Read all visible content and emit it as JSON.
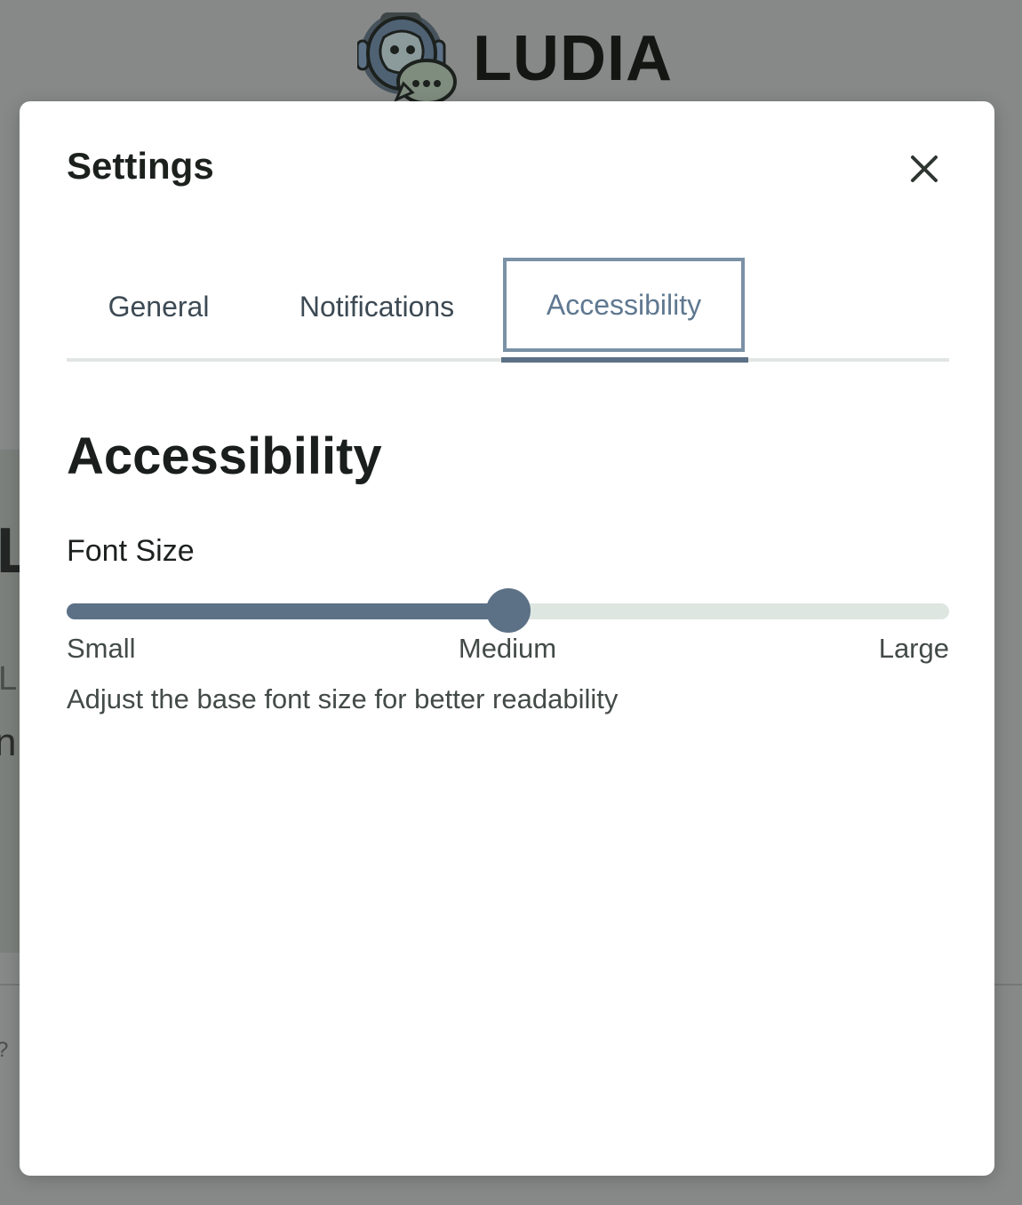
{
  "app": {
    "logo_text": "LUDIA",
    "logo_icon": "chat-robot-icon"
  },
  "background": {
    "glyph_1": "L",
    "glyph_2": "L",
    "glyph_3": "n",
    "glyph_4": "?"
  },
  "modal": {
    "title": "Settings",
    "close_icon": "close-icon",
    "tabs": [
      {
        "label": "General",
        "active": false
      },
      {
        "label": "Notifications",
        "active": false
      },
      {
        "label": "Accessibility",
        "active": true
      }
    ],
    "section_title": "Accessibility",
    "font_size": {
      "label": "Font Size",
      "options": [
        "Small",
        "Medium",
        "Large"
      ],
      "selected": "Medium",
      "value_fraction": 0.5,
      "help_text": "Adjust the base font size for better readability"
    }
  },
  "colors": {
    "accent": "#5c7186",
    "active_tab_border": "#7a91a6",
    "track": "#dde6e1",
    "overlay": "#868988"
  }
}
